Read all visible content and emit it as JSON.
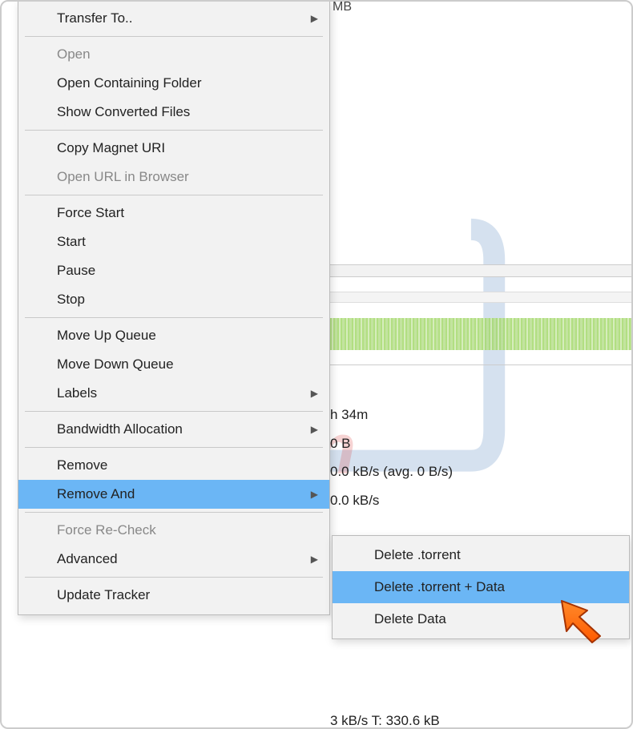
{
  "bg": {
    "header_fragment": "MB",
    "stats": {
      "time": "h 34m",
      "size": "0 B",
      "down": "0.0 kB/s (avg. 0 B/s)",
      "up": "0.0 kB/s"
    },
    "footer": "3 kB/s T: 330.6 kB"
  },
  "menu": {
    "transfer_to": "Transfer To..",
    "open": "Open",
    "open_containing": "Open Containing Folder",
    "show_converted": "Show Converted Files",
    "copy_magnet": "Copy Magnet URI",
    "open_url": "Open URL in Browser",
    "force_start": "Force Start",
    "start": "Start",
    "pause": "Pause",
    "stop": "Stop",
    "move_up": "Move Up Queue",
    "move_down": "Move Down Queue",
    "labels": "Labels",
    "bandwidth": "Bandwidth Allocation",
    "remove": "Remove",
    "remove_and": "Remove And",
    "force_recheck": "Force Re-Check",
    "advanced": "Advanced",
    "update_tracker": "Update Tracker"
  },
  "submenu": {
    "delete_torrent": "Delete .torrent",
    "delete_torrent_data": "Delete .torrent + Data",
    "delete_data": "Delete Data"
  }
}
